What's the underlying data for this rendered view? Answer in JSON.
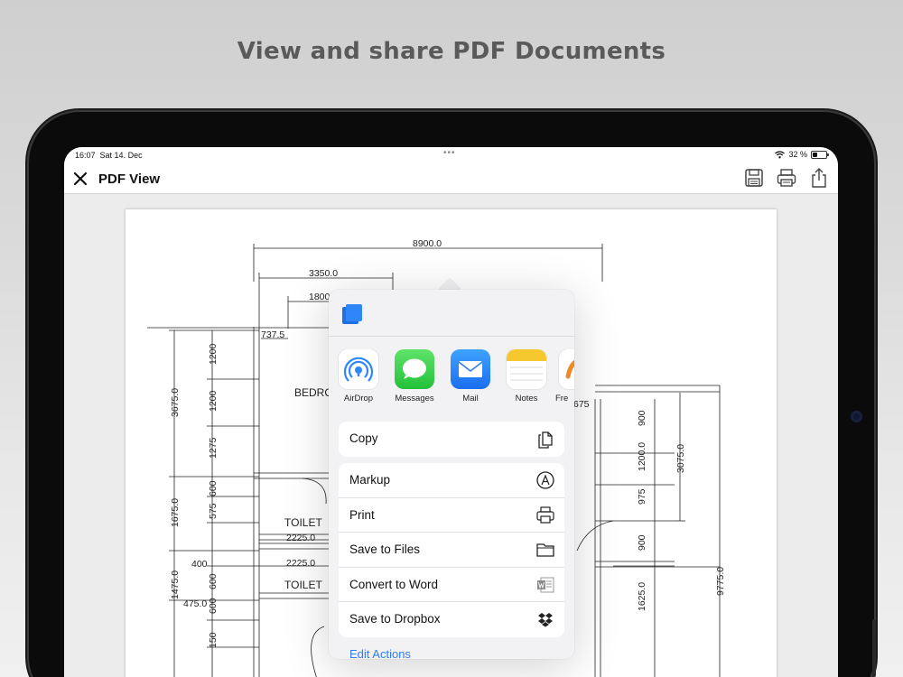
{
  "headline": "View and share PDF Documents",
  "status_bar": {
    "time": "16:07",
    "date": "Sat 14. Dec",
    "battery": "32 %"
  },
  "nav": {
    "title": "PDF View"
  },
  "icons": {
    "close": "close-icon",
    "save": "floppy-disk-icon",
    "print": "printer-icon",
    "share": "share-icon"
  },
  "drawing": {
    "labels": [
      "8900.0",
      "3350.0",
      "1800",
      "737.5",
      "BEDRO",
      "3675.0",
      "1200",
      "1200",
      "1275",
      "1675.0",
      "600",
      "575",
      "600",
      "TOILET",
      "2225.0",
      "400",
      "2225.0",
      "TOILET",
      "1475.0",
      "475.0",
      "600",
      "150",
      "675",
      "900",
      "1200.0",
      "975",
      "900",
      "1625.0",
      "3075.0",
      "9775.0"
    ]
  },
  "share_sheet": {
    "apps": [
      {
        "label": "AirDrop",
        "icon": "airdrop-icon"
      },
      {
        "label": "Messages",
        "icon": "messages-icon"
      },
      {
        "label": "Mail",
        "icon": "mail-icon"
      },
      {
        "label": "Notes",
        "icon": "notes-icon"
      },
      {
        "label": "Fre",
        "icon": "freeform-icon"
      }
    ],
    "copy": {
      "label": "Copy",
      "icon": "copy-icon"
    },
    "actions": [
      {
        "label": "Markup",
        "icon": "markup-icon"
      },
      {
        "label": "Print",
        "icon": "printer-icon"
      },
      {
        "label": "Save to Files",
        "icon": "folder-icon"
      },
      {
        "label": "Convert to Word",
        "icon": "word-icon"
      },
      {
        "label": "Save to Dropbox",
        "icon": "dropbox-icon"
      }
    ],
    "edit_actions": "Edit Actions"
  },
  "colors": {
    "accent": "#2f7cf6",
    "headline": "#5a5a5a"
  }
}
